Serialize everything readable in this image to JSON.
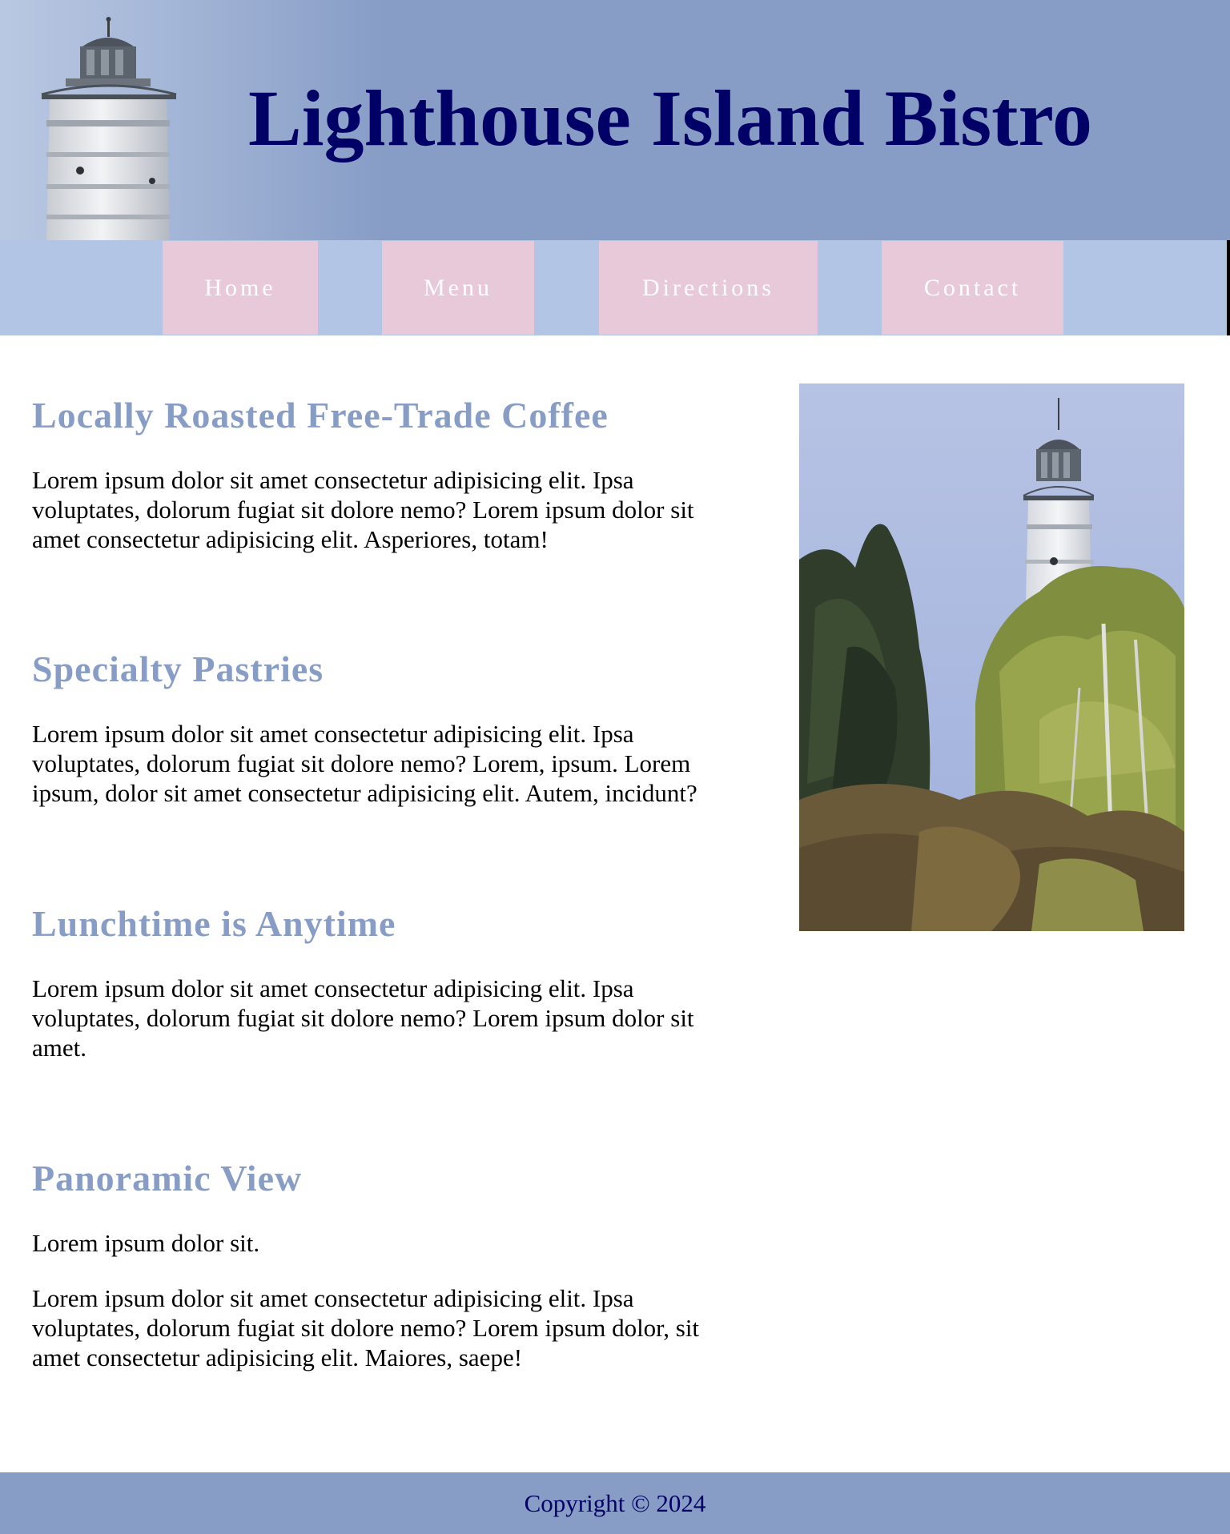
{
  "header": {
    "title": "Lighthouse Island Bistro",
    "photo_icon": "lighthouse-photo"
  },
  "nav": {
    "items": [
      {
        "label": "Home"
      },
      {
        "label": "Menu"
      },
      {
        "label": "Directions"
      },
      {
        "label": "Contact"
      }
    ]
  },
  "main": {
    "sections": [
      {
        "heading": "Locally Roasted Free-Trade Coffee",
        "paragraphs": [
          "Lorem ipsum dolor sit amet consectetur adipisicing elit. Ipsa voluptates, dolorum fugiat sit dolore nemo? Lorem ipsum dolor sit amet consectetur adipisicing elit. Asperiores, totam!"
        ]
      },
      {
        "heading": "Specialty Pastries",
        "paragraphs": [
          "Lorem ipsum dolor sit amet consectetur adipisicing elit. Ipsa voluptates, dolorum fugiat sit dolore nemo? Lorem, ipsum. Lorem ipsum, dolor sit amet consectetur adipisicing elit. Autem, incidunt?"
        ]
      },
      {
        "heading": "Lunchtime is Anytime",
        "paragraphs": [
          "Lorem ipsum dolor sit amet consectetur adipisicing elit. Ipsa voluptates, dolorum fugiat sit dolore nemo? Lorem ipsum dolor sit amet."
        ]
      },
      {
        "heading": "Panoramic View",
        "paragraphs": [
          "Lorem ipsum dolor sit.",
          "Lorem ipsum dolor sit amet consectetur adipisicing elit. Ipsa voluptates, dolorum fugiat sit dolore nemo? Lorem ipsum dolor, sit amet consectetur adipisicing elit. Maiores, saepe!"
        ]
      }
    ],
    "side_photo_icon": "lighthouse-trees-photo"
  },
  "footer": {
    "text": "Copyright © 2024"
  },
  "colors": {
    "header_bg": "#879dc6",
    "title": "#000066",
    "nav_bg": "#b3c5e5",
    "nav_item_bg": "#e8c9da",
    "heading": "#879dc6",
    "footer_text": "#000066"
  }
}
